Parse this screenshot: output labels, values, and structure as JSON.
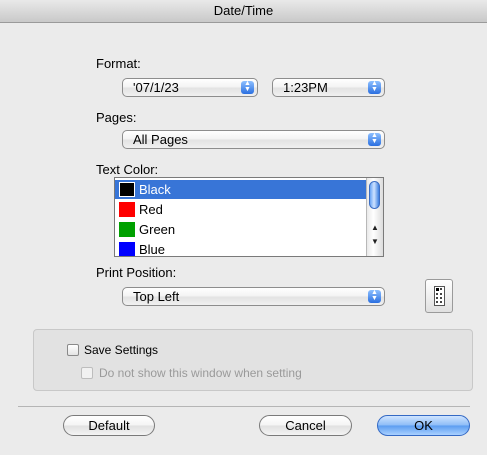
{
  "window": {
    "title": "Date/Time"
  },
  "format": {
    "label": "Format:",
    "date_value": "'07/1/23",
    "time_value": "1:23PM"
  },
  "pages": {
    "label": "Pages:",
    "value": "All Pages"
  },
  "text_color": {
    "label": "Text Color:",
    "items": [
      {
        "label": "Black",
        "color": "#000000",
        "selected": true
      },
      {
        "label": "Red",
        "color": "#ff0000",
        "selected": false
      },
      {
        "label": "Green",
        "color": "#00a000",
        "selected": false
      },
      {
        "label": "Blue",
        "color": "#0000ff",
        "selected": false
      }
    ]
  },
  "print_position": {
    "label": "Print Position:",
    "value": "Top Left",
    "icon": "page-position-icon"
  },
  "settings": {
    "save_label": "Save Settings",
    "save_checked": false,
    "dont_show_label": "Do not show this window when setting",
    "dont_show_checked": false,
    "dont_show_enabled": false
  },
  "buttons": {
    "default": "Default",
    "cancel": "Cancel",
    "ok": "OK"
  },
  "colors": {
    "accent": "#3875d7",
    "window_bg": "#ebebeb"
  }
}
